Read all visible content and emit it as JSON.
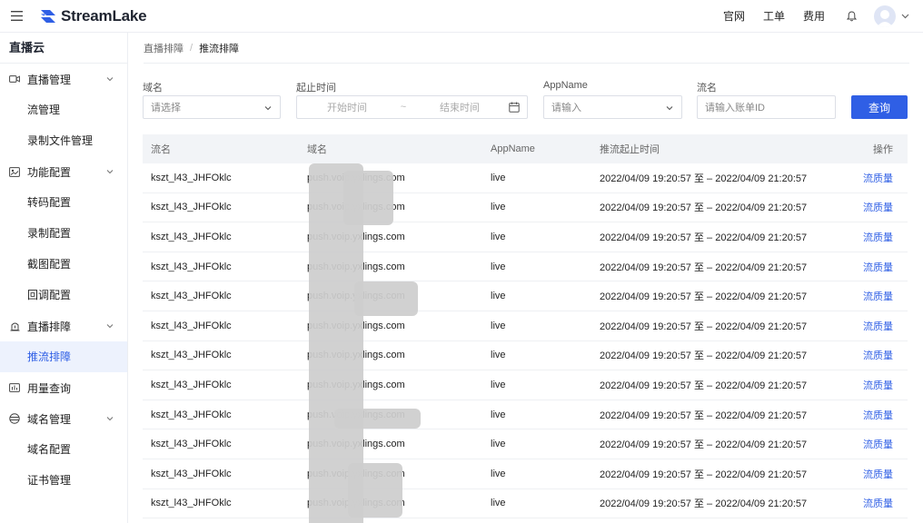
{
  "header": {
    "brand": "StreamLake",
    "links": [
      "官网",
      "工单",
      "费用"
    ]
  },
  "sidebar": {
    "title": "直播云",
    "groups": [
      {
        "label": "直播管理",
        "icon": "video-camera-icon",
        "items": [
          "流管理",
          "录制文件管理"
        ]
      },
      {
        "label": "功能配置",
        "icon": "settings-panel-icon",
        "items": [
          "转码配置",
          "录制配置",
          "截图配置",
          "回调配置"
        ]
      },
      {
        "label": "直播排障",
        "icon": "diagnose-icon",
        "items": [
          "推流排障"
        ]
      },
      {
        "label": "用量查询",
        "icon": "usage-chart-icon",
        "items": []
      },
      {
        "label": "域名管理",
        "icon": "globe-icon",
        "items": [
          "域名配置",
          "证书管理"
        ]
      }
    ],
    "active_item": "推流排障"
  },
  "breadcrumb": {
    "parent": "直播排障",
    "current": "推流排障"
  },
  "filters": {
    "domain": {
      "label": "域名",
      "placeholder": "请选择"
    },
    "time": {
      "label": "起止时间",
      "start_placeholder": "开始时间",
      "end_placeholder": "结束时间",
      "separator": "~"
    },
    "appname": {
      "label": "AppName",
      "placeholder": "请输入"
    },
    "stream": {
      "label": "流名",
      "placeholder": "请输入账单ID"
    },
    "search_label": "查询"
  },
  "table": {
    "columns": [
      "流名",
      "域名",
      "AppName",
      "推流起止时间",
      "操作"
    ],
    "rows": [
      {
        "stream": "kszt_l43_JHFOklc",
        "domain": "push.voip.yxlings.com",
        "app": "live",
        "time": "2022/04/09 19:20:57 至 – 2022/04/09 21:20:57",
        "action": "流质量"
      },
      {
        "stream": "kszt_l43_JHFOklc",
        "domain": "push.voip.yxlings.com",
        "app": "live",
        "time": "2022/04/09 19:20:57 至 – 2022/04/09 21:20:57",
        "action": "流质量"
      },
      {
        "stream": "kszt_l43_JHFOklc",
        "domain": "push.voip.yxlings.com",
        "app": "live",
        "time": "2022/04/09 19:20:57 至 – 2022/04/09 21:20:57",
        "action": "流质量"
      },
      {
        "stream": "kszt_l43_JHFOklc",
        "domain": "push.voip.yxlings.com",
        "app": "live",
        "time": "2022/04/09 19:20:57 至 – 2022/04/09 21:20:57",
        "action": "流质量"
      },
      {
        "stream": "kszt_l43_JHFOklc",
        "domain": "push.voip.yxlings.com",
        "app": "live",
        "time": "2022/04/09 19:20:57 至 – 2022/04/09 21:20:57",
        "action": "流质量"
      },
      {
        "stream": "kszt_l43_JHFOklc",
        "domain": "push.voip.yxlings.com",
        "app": "live",
        "time": "2022/04/09 19:20:57 至 – 2022/04/09 21:20:57",
        "action": "流质量"
      },
      {
        "stream": "kszt_l43_JHFOklc",
        "domain": "push.voip.yxlings.com",
        "app": "live",
        "time": "2022/04/09 19:20:57 至 – 2022/04/09 21:20:57",
        "action": "流质量"
      },
      {
        "stream": "kszt_l43_JHFOklc",
        "domain": "push.voip.yxlings.com",
        "app": "live",
        "time": "2022/04/09 19:20:57 至 – 2022/04/09 21:20:57",
        "action": "流质量"
      },
      {
        "stream": "kszt_l43_JHFOklc",
        "domain": "push.voip.yxlings.com",
        "app": "live",
        "time": "2022/04/09 19:20:57 至 – 2022/04/09 21:20:57",
        "action": "流质量"
      },
      {
        "stream": "kszt_l43_JHFOklc",
        "domain": "push.voip.yxlings.com",
        "app": "live",
        "time": "2022/04/09 19:20:57 至 – 2022/04/09 21:20:57",
        "action": "流质量"
      },
      {
        "stream": "kszt_l43_JHFOklc",
        "domain": "push.voip.yxlings.com",
        "app": "live",
        "time": "2022/04/09 19:20:57 至 – 2022/04/09 21:20:57",
        "action": "流质量"
      },
      {
        "stream": "kszt_l43_JHFOklc",
        "domain": "push.voip.yxlings.com",
        "app": "live",
        "time": "2022/04/09 19:20:57 至 – 2022/04/09 21:20:57",
        "action": "流质量"
      }
    ]
  },
  "colors": {
    "primary": "#2f5fe5",
    "active_bg": "#edf2fd",
    "header_bg": "#f2f4f7"
  }
}
